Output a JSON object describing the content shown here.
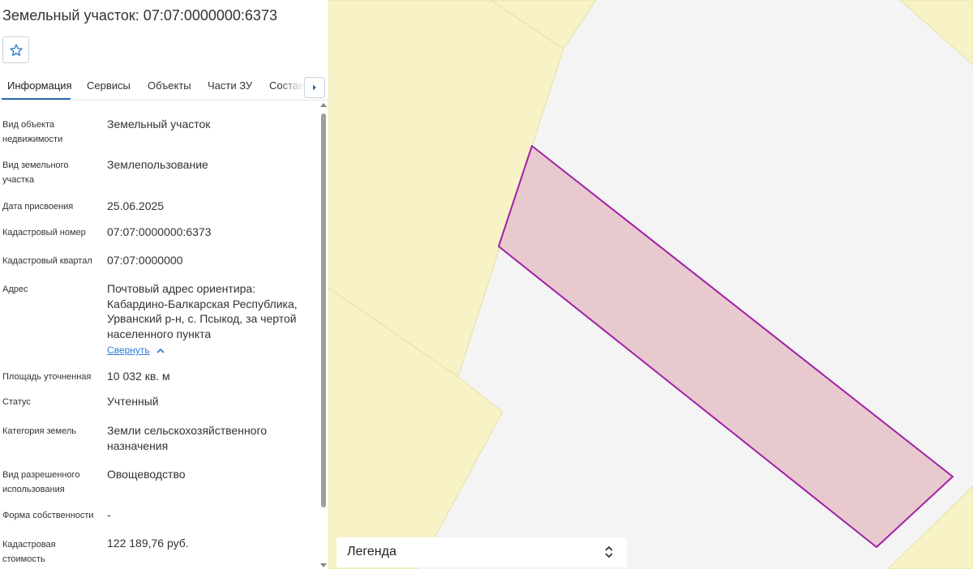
{
  "header": {
    "title": "Земельный участок: 07:07:0000000:6373"
  },
  "tabs": [
    {
      "label": "Информация"
    },
    {
      "label": "Сервисы"
    },
    {
      "label": "Объекты"
    },
    {
      "label": "Части ЗУ"
    },
    {
      "label": "Состав"
    }
  ],
  "details": [
    {
      "label": "Вид объекта недвижимости",
      "value": "Земельный участок"
    },
    {
      "label": "Вид земельного участка",
      "value": "Землепользование"
    },
    {
      "label": "Дата присвоения",
      "value": "25.06.2025"
    },
    {
      "label": "Кадастровый номер",
      "value": "07:07:0000000:6373"
    },
    {
      "label": "Кадастровый квартал",
      "value": "07:07:0000000"
    },
    {
      "label": "Адрес",
      "value": "Почтовый адрес ориентира: Кабардино-Балкарская Республика, Урванский р-н, с. Псыкод, за чертой населенного пункта"
    },
    {
      "label": "Площадь уточненная",
      "value": "10 032 кв. м"
    },
    {
      "label": "Статус",
      "value": "Учтенный"
    },
    {
      "label": "Категория земель",
      "value": "Земли сельскохозяйственного назначения"
    },
    {
      "label": "Вид разрешенного использования",
      "value": "Овощеводство"
    },
    {
      "label": "Форма собственности",
      "value": "-"
    },
    {
      "label": "Кадастровая стоимость",
      "value": "122 189,76 руб."
    }
  ],
  "address_toggle_label": "Свернуть",
  "map": {
    "legend_label": "Легенда",
    "colors": {
      "background": "#f4f4f4",
      "land_fill": "#f7f3c6",
      "land_stroke": "#e5e0a8",
      "parcel_fill": "#e8c9cd",
      "parcel_stroke": "#a020a8"
    }
  },
  "icons": {
    "favorite": "star-outline-icon",
    "tabs_next": "caret-right-icon",
    "collapse": "chevron-up-icon",
    "legend_toggle": "up-down-chevron-icon"
  },
  "accent_color": "#2b6cb0"
}
